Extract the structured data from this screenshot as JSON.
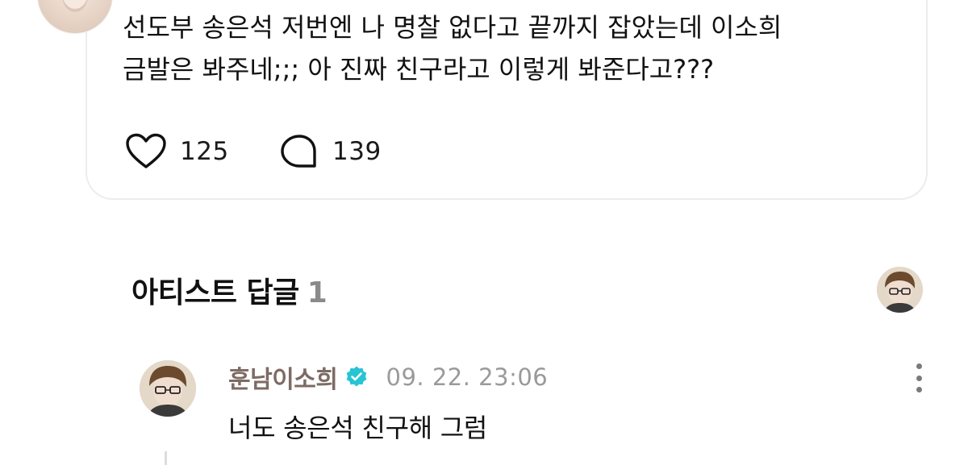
{
  "post": {
    "text_line1": "선도부 송은석 저번엔 나 명찰 없다고 끝까지 잡았는데 이소희",
    "text_line2": "금발은 봐주네;;; 아 진짜 친구라고 이렇게 봐준다고???",
    "like_icon": "heart-outline-icon",
    "like_count": "125",
    "comment_icon": "speech-bubble-icon",
    "comment_count": "139"
  },
  "artist_replies": {
    "title": "아티스트 답글",
    "count": "1"
  },
  "reply": {
    "author": "훈남이소희",
    "verified_icon": "verified-badge-icon",
    "timestamp": "09. 22. 23:06",
    "text": "너도 송은석 친구해 그럼",
    "menu_icon": "more-vertical-icon"
  },
  "colors": {
    "verified_badge": "#27c4d4",
    "author_name": "#7d6b64",
    "timestamp": "#9a9a9a",
    "card_border": "#ececec"
  }
}
